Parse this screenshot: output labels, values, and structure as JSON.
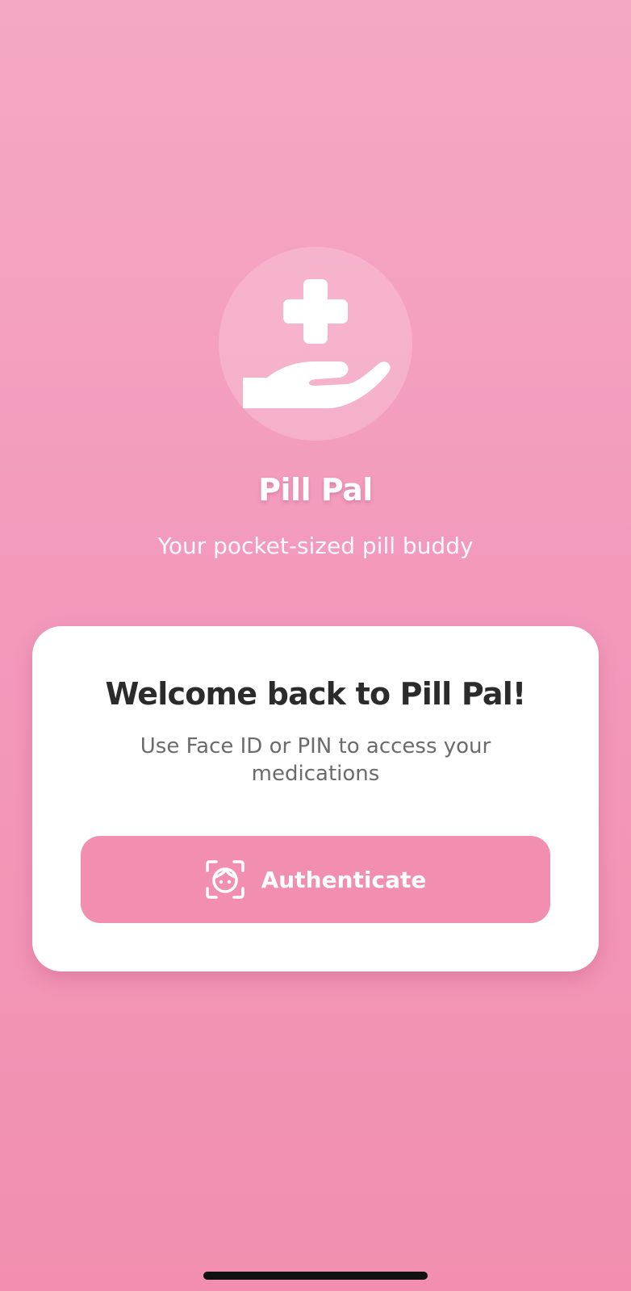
{
  "app": {
    "name": "Pill Pal",
    "tagline": "Your pocket-sized pill buddy",
    "logo_icon": "hand-holding-medical-icon"
  },
  "login_card": {
    "title": "Welcome back to Pill Pal!",
    "subtitle": "Use Face ID or PIN to access your medications",
    "auth_button": {
      "label": "Authenticate",
      "icon": "face-id-icon"
    }
  },
  "colors": {
    "background_top": "#f4a8c3",
    "background_bottom": "#f28fb0",
    "accent": "#f28fb1",
    "card": "#ffffff",
    "title_text": "#2b2b2b",
    "subtitle_text": "#6b6b6b"
  }
}
